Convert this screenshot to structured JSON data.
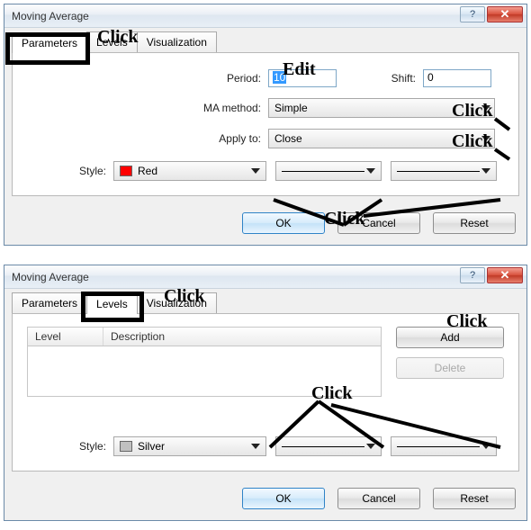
{
  "dialogs": [
    {
      "title": "Moving Average",
      "tabs": [
        "Parameters",
        "Levels",
        "Visualization"
      ],
      "activeTab": "Parameters",
      "fields": {
        "period_label": "Period:",
        "period_value": "10",
        "shift_label": "Shift:",
        "shift_value": "0",
        "ma_method_label": "MA method:",
        "ma_method_value": "Simple",
        "apply_to_label": "Apply to:",
        "apply_to_value": "Close",
        "style_label": "Style:",
        "style_color_name": "Red",
        "style_color_hex": "#ff0000"
      },
      "buttons": {
        "ok": "OK",
        "cancel": "Cancel",
        "reset": "Reset"
      },
      "annotations": {
        "tab": "Click",
        "period": "Edit",
        "ma": "Click",
        "apply": "Click",
        "style": "Click"
      }
    },
    {
      "title": "Moving Average",
      "tabs": [
        "Parameters",
        "Levels",
        "Visualization"
      ],
      "activeTab": "Levels",
      "list": {
        "col_level": "Level",
        "col_desc": "Description"
      },
      "side": {
        "add": "Add",
        "delete": "Delete"
      },
      "fields": {
        "style_label": "Style:",
        "style_color_name": "Silver",
        "style_color_hex": "#c0c0c0"
      },
      "buttons": {
        "ok": "OK",
        "cancel": "Cancel",
        "reset": "Reset"
      },
      "annotations": {
        "tab": "Click",
        "add": "Click",
        "style": "Click"
      }
    }
  ]
}
